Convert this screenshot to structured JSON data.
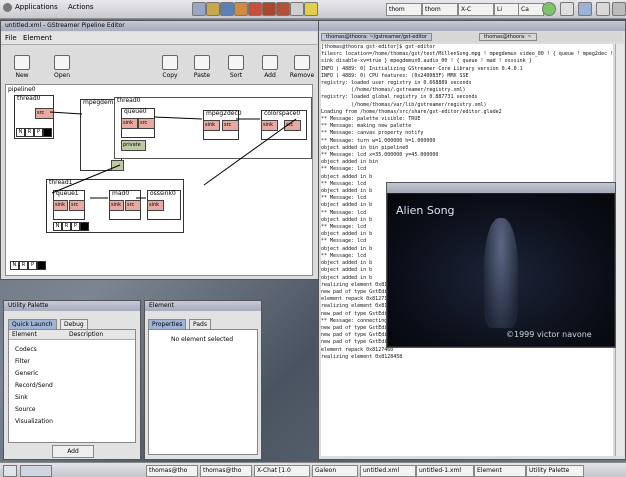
{
  "top_panel": {
    "applications": "Applications",
    "actions": "Actions",
    "tasks": [
      "thom",
      "thom",
      "X-C",
      "Li",
      "Ca"
    ]
  },
  "pipeline_window": {
    "title": "untitled.xml - GStreamer Pipeline Editor",
    "menu": [
      "File",
      "Element"
    ],
    "tools": [
      "New",
      "Open",
      "Copy",
      "Paste",
      "Sort",
      "Add",
      "Remove"
    ],
    "elements": {
      "pipeline": "pipeline0",
      "thread0": "thread0",
      "mpegdemux": "mpegdemux0",
      "thread_main": "thread0",
      "queue0": "queue0",
      "mpeg2dec": "mpeg2dec0",
      "colorspace": "colorspace0",
      "thread1": "thread1",
      "queue1": "queue1",
      "mad": "mad0",
      "osssink": "osssink0"
    },
    "pads": {
      "src": "src",
      "sink": "sink",
      "private": "private"
    },
    "state_labels": [
      "N",
      "R",
      "P",
      "P"
    ]
  },
  "terminal": {
    "tabs": [
      "thomas@thoora: ~/gstreamer/gst-editor",
      "thomas@thoora: ~"
    ],
    "lines": [
      "[thomas@thoora gst-editor]$ gst-editor",
      "filesrc location=/home/thomas/gst/test/MillenSong.mpg ! mpegdemux video_00 ! { queue ! mpeg2dec ! colorspace ! xvideo",
      "sink disable-xv=true } mpegdemux0.audio_00 ! { queue ! mad ! osssink }",
      "INFO ( 4889: 0) Initializing GStreamer Core Library version 0.4.0.1",
      "INFO ( 4889: 0) CPU features: (0x240083F) MMX SSE",
      "registry: loaded user registry in 0.668889 seconds",
      "          (/home/thomas/.gstreamer/registry.xml)",
      "registry: loaded global registry in 0.887731 seconds",
      "          (/home/thomas/var/lib/gstreamer/registry.xml)",
      "Loading from /home/thomas/src/share/gst-editor/editor.glade2",
      "** Message: palette visible: TRUE",
      "** Message: making new palette",
      "** Message: canvas property notify",
      "** Message: turn w=1.000000 h=1.000000",
      "object added in bin pipeline0",
      "** Message: lcd x=35.000000 y=45.000000",
      "object added in bin",
      "** Message: lcd",
      "object added in b",
      "** Message: lcd",
      "object added in b",
      "** Message: lcd",
      "object added in b",
      "** Message: lcd",
      "object added in b",
      "** Message: lcd",
      "object added in b",
      "** Message: lcd",
      "object added in b",
      "** Message: lcd",
      "object added in b",
      "object added in b",
      "object added in b",
      "realizing element 0x8127100",
      "new pad of type GstEditorPadImage (0x8123230)",
      "element repack 0x8127100",
      "realizing element 0x8127460",
      "new pad of type GstEditorPadImage (0x8227170)",
      "** Message: connecting GUI for mpegdemux0:video and filesrcSpace",
      "new pad of type GstEditorPadAlways (0x8225da0)",
      "new pad of type GstEditorPadSometimes (0x822c858)",
      "new pad of type GstEditorPadSometimes (0x822c128)",
      "element repack 0x8127460",
      "realizing element 0x8128458"
    ]
  },
  "video_window": {
    "caption": "Alien Song",
    "copyright": "©1999 victor navone"
  },
  "utility_palette": {
    "title": "Utility Palette",
    "tabs": [
      "Quick Launch",
      "Debug"
    ],
    "columns": [
      "Element",
      "Description"
    ],
    "items": [
      "Codecs",
      "Filter",
      "Generic",
      "Record/Send",
      "Sink",
      "Source",
      "Visualization"
    ],
    "add_label": "Add"
  },
  "element_window": {
    "title": "Element",
    "tabs": [
      "Properties",
      "Pads"
    ],
    "message": "No element selected"
  },
  "bottom_taskbar": {
    "items": [
      "thomas@tho",
      "thomas@tho",
      "X-Chat [1.0",
      "Galeon",
      "untitled.xml",
      "untitled-1.xml",
      "Element",
      "Utility Palette"
    ]
  }
}
